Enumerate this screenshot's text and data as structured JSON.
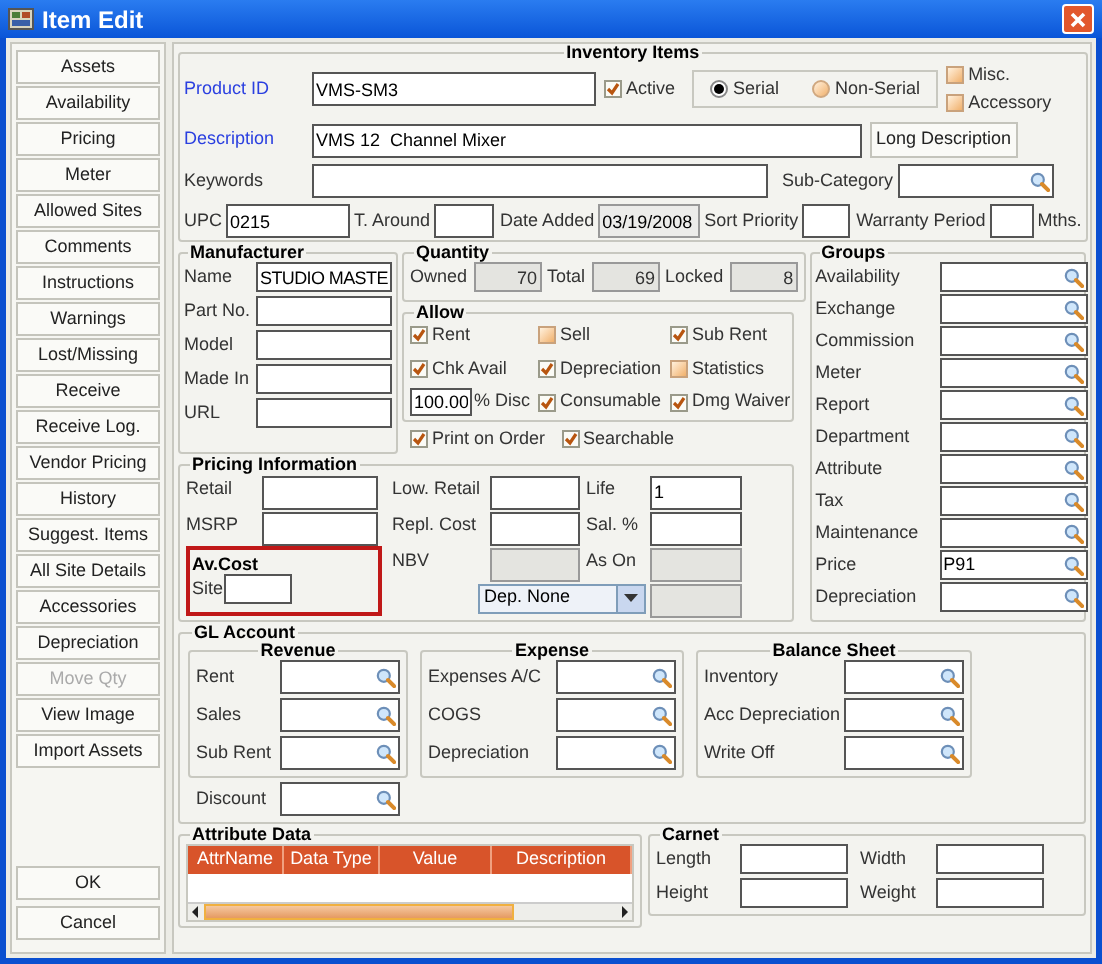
{
  "window": {
    "title": "Item Edit"
  },
  "sidebar": {
    "buttons": [
      {
        "label": "Assets",
        "disabled": false
      },
      {
        "label": "Availability",
        "disabled": false
      },
      {
        "label": "Pricing",
        "disabled": false
      },
      {
        "label": "Meter",
        "disabled": false
      },
      {
        "label": "Allowed Sites",
        "disabled": false
      },
      {
        "label": "Comments",
        "disabled": false
      },
      {
        "label": "Instructions",
        "disabled": false
      },
      {
        "label": "Warnings",
        "disabled": false
      },
      {
        "label": "Lost/Missing",
        "disabled": false
      },
      {
        "label": "Receive",
        "disabled": false
      },
      {
        "label": "Receive Log.",
        "disabled": false
      },
      {
        "label": "Vendor Pricing",
        "disabled": false
      },
      {
        "label": "History",
        "disabled": false
      },
      {
        "label": "Suggest. Items",
        "disabled": false
      },
      {
        "label": "All Site Details",
        "disabled": false
      },
      {
        "label": "Accessories",
        "disabled": false
      },
      {
        "label": "Depreciation",
        "disabled": false
      },
      {
        "label": "Move Qty",
        "disabled": true
      },
      {
        "label": "View Image",
        "disabled": false
      },
      {
        "label": "Import Assets",
        "disabled": false
      }
    ],
    "bottom_buttons": [
      "OK",
      "Cancel"
    ]
  },
  "inventory_items": {
    "title": "Inventory Items",
    "product_id": {
      "label": "Product ID",
      "value": "VMS-SM3",
      "required": true
    },
    "active": {
      "label": "Active",
      "checked": true
    },
    "serial_type": [
      {
        "label": "Serial",
        "selected": true
      },
      {
        "label": "Non-Serial",
        "selected": false
      }
    ],
    "flags": [
      {
        "label": "Misc.",
        "checked": false
      },
      {
        "label": "Accessory",
        "checked": false
      }
    ],
    "description": {
      "label": "Description",
      "value": "VMS 12  Channel Mixer",
      "required": true
    },
    "long_description_button": "Long Description",
    "keywords": {
      "label": "Keywords",
      "required": false
    },
    "sub_category": {
      "label": "Sub-Category"
    },
    "upc": {
      "label": "UPC",
      "value": "0215"
    },
    "t_around": {
      "label": "T. Around"
    },
    "date_added": {
      "label": "Date Added",
      "value": "03/19/2008"
    },
    "sort_priority": {
      "label": "Sort Priority"
    },
    "warranty_period": {
      "label": "Warranty Period",
      "unit": "Mths."
    }
  },
  "manufacturer": {
    "title": "Manufacturer",
    "fields": [
      {
        "label": "Name",
        "value": "STUDIO MASTE"
      },
      {
        "label": "Part No."
      },
      {
        "label": "Model"
      },
      {
        "label": "Made In"
      },
      {
        "label": "URL"
      }
    ]
  },
  "quantity": {
    "title": "Quantity",
    "fields": [
      {
        "label": "Owned",
        "value": "70",
        "disabled": true
      },
      {
        "label": "Total",
        "value": "69",
        "disabled": true
      },
      {
        "label": "Locked",
        "value": "8",
        "disabled": true
      }
    ]
  },
  "allow": {
    "title": "Allow",
    "checks": [
      {
        "label": "Rent",
        "checked": true
      },
      {
        "label": "Sell",
        "checked": false
      },
      {
        "label": "Sub Rent",
        "checked": true
      },
      {
        "label": "Chk Avail",
        "checked": true
      },
      {
        "label": "Depreciation",
        "checked": true
      },
      {
        "label": "Statistics",
        "checked": false
      },
      {
        "label": "Consumable",
        "checked": true
      },
      {
        "label": "Dmg Waiver",
        "checked": true
      }
    ],
    "disc": {
      "value": "100.00",
      "label": "% Disc"
    },
    "bottom_checks": [
      {
        "label": "Print on Order",
        "checked": true
      },
      {
        "label": "Searchable",
        "checked": true
      }
    ]
  },
  "groups": {
    "title": "Groups",
    "fields": [
      {
        "label": "Availability"
      },
      {
        "label": "Exchange"
      },
      {
        "label": "Commission"
      },
      {
        "label": "Meter"
      },
      {
        "label": "Report"
      },
      {
        "label": "Department"
      },
      {
        "label": "Attribute"
      },
      {
        "label": "Tax"
      },
      {
        "label": "Maintenance"
      },
      {
        "label": "Price",
        "value": "P91"
      },
      {
        "label": "Depreciation"
      }
    ]
  },
  "pricing": {
    "title": "Pricing Information",
    "left": [
      {
        "label": "Retail"
      },
      {
        "label": "MSRP"
      }
    ],
    "middle": [
      {
        "label": "Low. Retail",
        "disabled": false
      },
      {
        "label": "Repl. Cost",
        "disabled": false
      },
      {
        "label": "NBV",
        "disabled": true
      }
    ],
    "right": [
      {
        "label": "Life",
        "value": "1",
        "disabled": false
      },
      {
        "label": "Sal. %",
        "disabled": false
      },
      {
        "label": "As On",
        "disabled": true
      },
      {
        "disabled": true
      }
    ],
    "av_cost": {
      "title": "Av.Cost",
      "site_label": "Site"
    },
    "dep_select": {
      "value": "Dep. None"
    }
  },
  "gl_account": {
    "title": "GL Account",
    "sections": [
      {
        "title": "Revenue",
        "fields": [
          {
            "label": "Rent"
          },
          {
            "label": "Sales"
          },
          {
            "label": "Sub Rent"
          }
        ]
      },
      {
        "title": "Expense",
        "fields": [
          {
            "label": "Expenses A/C"
          },
          {
            "label": "COGS"
          },
          {
            "label": "Depreciation"
          }
        ]
      },
      {
        "title": "Balance Sheet",
        "fields": [
          {
            "label": "Inventory"
          },
          {
            "label": "Acc Depreciation"
          },
          {
            "label": "Write Off"
          }
        ]
      }
    ],
    "discount": {
      "label": "Discount"
    }
  },
  "attribute_data": {
    "title": "Attribute Data",
    "columns": [
      "AttrName",
      "Data Type",
      "Value",
      "Description"
    ]
  },
  "carnet": {
    "title": "Carnet",
    "fields": [
      {
        "label": "Length"
      },
      {
        "label": "Width"
      },
      {
        "label": "Height"
      },
      {
        "label": "Weight"
      }
    ]
  }
}
